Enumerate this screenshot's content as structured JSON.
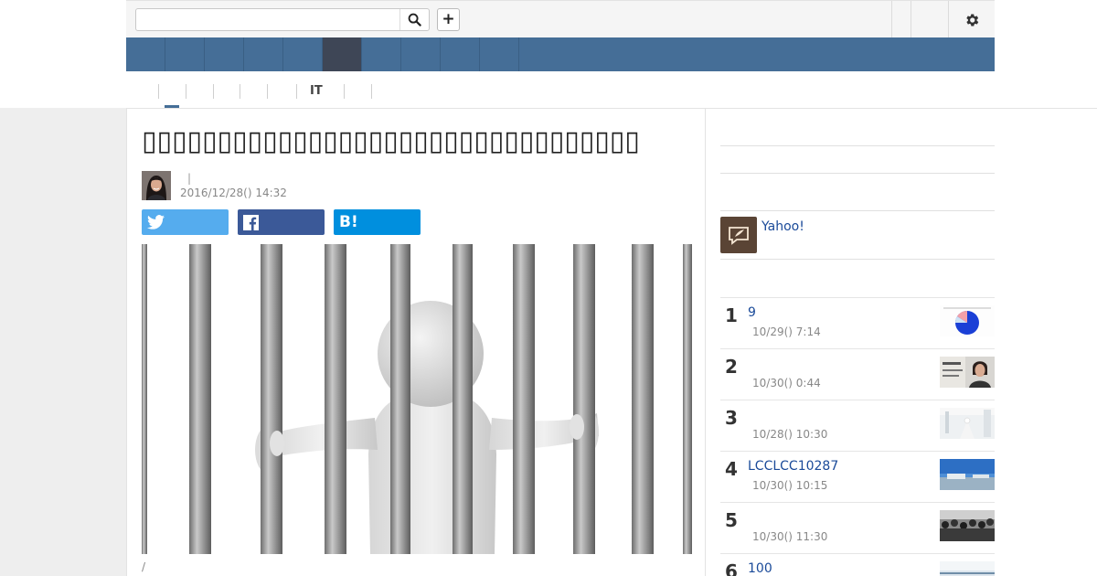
{
  "header": {
    "search_value": "",
    "search_placeholder": "",
    "plus_label": "+",
    "search_icon": "search-icon",
    "settings_icon": "gear-icon"
  },
  "gnav": {
    "items": [
      "",
      "",
      "",
      "",
      "",
      "",
      "",
      "",
      "",
      ""
    ],
    "active_index": 5,
    "color": "#456e97",
    "active_color": "#3e4656"
  },
  "subnav": {
    "items": [
      "",
      "",
      "",
      "",
      "",
      "IT",
      ""
    ],
    "active_index": 0
  },
  "article": {
    "title": "▯▯▯▯▯▯▯▯▯▯▯▯▯▯▯▯▯▯▯▯▯▯▯▯▯▯▯▯▯▯▯▯▯",
    "author_separator": "|",
    "date": "2016/12/28() 14:32",
    "caption": "/",
    "share": {
      "twitter_icon": "twitter-icon",
      "facebook_icon": "facebook-icon",
      "hatena_label": "B!",
      "twitter_color": "#55acee",
      "facebook_color": "#3b5998",
      "hatena_color": "#008fde"
    }
  },
  "sidebar": {
    "promo_text": "Yahoo!",
    "promo_icon": "feather-icon",
    "ranking": [
      {
        "rank": "1",
        "title": "9",
        "time": "10/29() 7:14"
      },
      {
        "rank": "2",
        "title": "",
        "time": "10/30() 0:44"
      },
      {
        "rank": "3",
        "title": "",
        "time": "10/28() 10:30"
      },
      {
        "rank": "4",
        "title": "LCCLCC10287",
        "time": "10/30() 10:15"
      },
      {
        "rank": "5",
        "title": "",
        "time": "10/30() 11:30"
      },
      {
        "rank": "6",
        "title": "100",
        "time": ""
      }
    ]
  }
}
